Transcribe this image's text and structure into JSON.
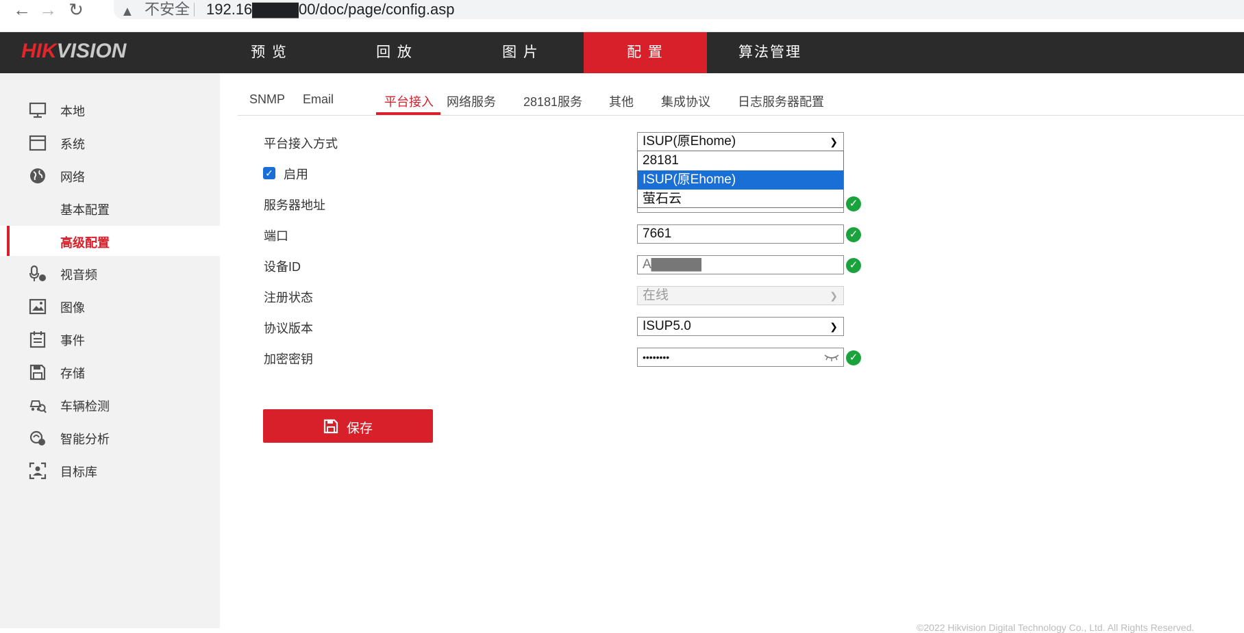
{
  "browser": {
    "warn_icon": "warning-triangle-icon",
    "insecure_label": "不安全",
    "url": "192.16▇▇▇▇00/doc/page/config.asp"
  },
  "topnav": {
    "logo_hik": "HIK",
    "logo_vision": "VISION",
    "items": [
      {
        "label": "预 览"
      },
      {
        "label": "回 放"
      },
      {
        "label": "图 片"
      },
      {
        "label": "配 置",
        "active": true
      },
      {
        "label": "算法管理"
      }
    ]
  },
  "sidebar": {
    "items": [
      {
        "label": "本地",
        "icon": "monitor-icon"
      },
      {
        "label": "系统",
        "icon": "system-icon"
      },
      {
        "label": "网络",
        "icon": "globe-icon"
      }
    ],
    "subitems": [
      {
        "label": "基本配置"
      },
      {
        "label": "高级配置",
        "active": true
      }
    ],
    "items2": [
      {
        "label": "视音频",
        "icon": "microphone-icon"
      },
      {
        "label": "图像",
        "icon": "image-icon"
      },
      {
        "label": "事件",
        "icon": "calendar-icon"
      },
      {
        "label": "存储",
        "icon": "save-icon"
      },
      {
        "label": "车辆检测",
        "icon": "vehicle-icon"
      },
      {
        "label": "智能分析",
        "icon": "smart-analysis-icon"
      },
      {
        "label": "目标库",
        "icon": "target-library-icon"
      }
    ]
  },
  "tabs": [
    {
      "label": "SNMP"
    },
    {
      "label": "Email"
    },
    {
      "label": "平台接入",
      "active": true
    },
    {
      "label": "网络服务"
    },
    {
      "label": "28181服务"
    },
    {
      "label": "其他"
    },
    {
      "label": "集成协议"
    },
    {
      "label": "日志服务器配置"
    }
  ],
  "form": {
    "access_mode_label": "平台接入方式",
    "access_mode_value": "ISUP(原Ehome)",
    "enable_label": "启用",
    "enable_checked": true,
    "server_label": "服务器地址",
    "port_label": "端口",
    "port_value": "7661",
    "device_id_label": "设备ID",
    "device_id_value": "A▇▇▇▇▇",
    "reg_status_label": "注册状态",
    "reg_status_value": "在线",
    "protocol_label": "协议版本",
    "protocol_value": "ISUP5.0",
    "key_label": "加密密钥",
    "key_value": "••••••••",
    "dropdown_options": [
      {
        "label": "28181"
      },
      {
        "label": "ISUP(原Ehome)",
        "selected": true
      },
      {
        "label": "萤石云"
      }
    ]
  },
  "save_label": "保存",
  "footer": "©2022 Hikvision Digital Technology Co., Ltd. All Rights Reserved."
}
